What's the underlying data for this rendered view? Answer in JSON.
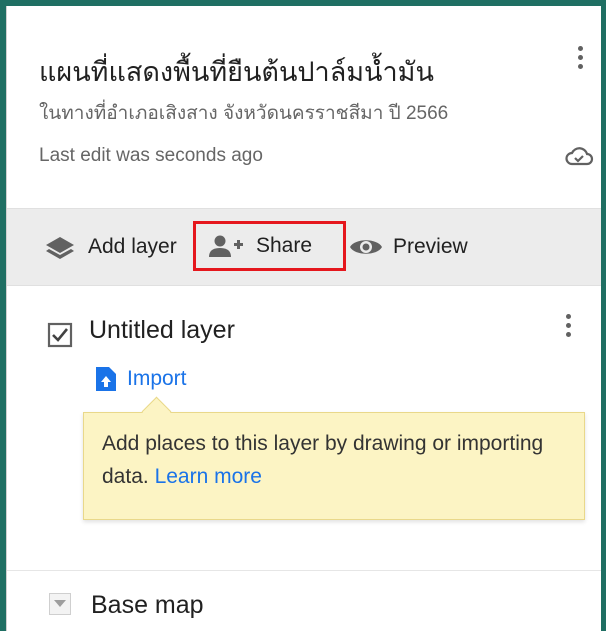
{
  "map": {
    "title": "แผนที่แสดงพื้นที่ยืนต้นปาล์มน้ำมัน",
    "description": "ในทางที่อำเภอเสิงสาง จังหวัดนครราชสีมา ปี 2566",
    "last_edit": "Last edit was seconds ago"
  },
  "toolbar": {
    "add_layer_label": "Add layer",
    "share_label": "Share",
    "preview_label": "Preview"
  },
  "layer": {
    "name": "Untitled layer",
    "checked": true,
    "import_label": "Import"
  },
  "tooltip": {
    "text": "Add places to this layer by drawing or importing data.",
    "link_text": "Learn more"
  },
  "base_map": {
    "label": "Base map"
  },
  "colors": {
    "background_frame": "#1f6f63",
    "toolbar_bg": "#ececec",
    "accent_link": "#1a73e8",
    "highlight_border": "#e5171d",
    "tooltip_bg": "#fcf4c4"
  },
  "icons": [
    "more-vert-icon",
    "cloud-done-icon",
    "layers-icon",
    "person-add-icon",
    "eye-icon",
    "checkbox-icon",
    "import-file-icon",
    "dropdown-arrow-icon"
  ]
}
